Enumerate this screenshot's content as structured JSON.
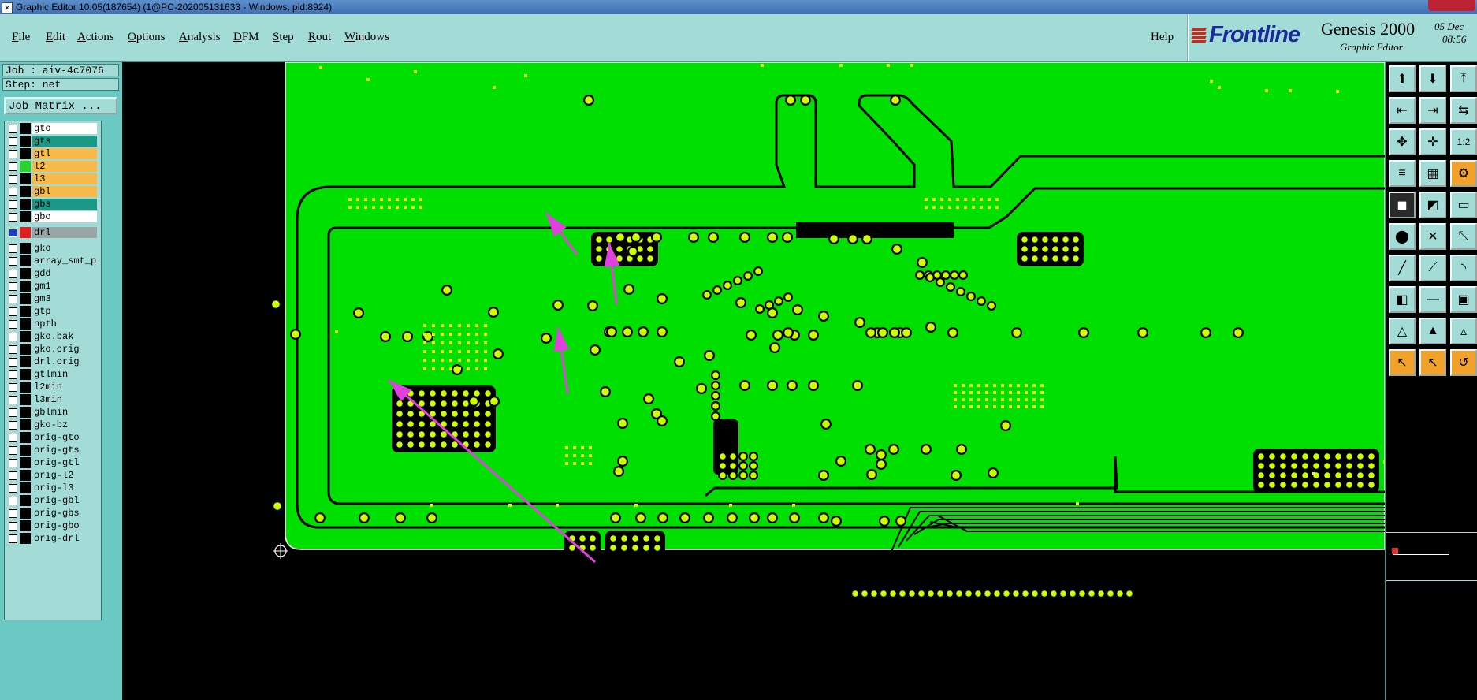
{
  "window": {
    "title": "Graphic Editor 10.05(187654) (1@PC-202005131633 - Windows, pid:8924)",
    "icon": "app-icon"
  },
  "menubar": {
    "items": [
      {
        "label": "File",
        "u": "F",
        "rest": "ile"
      },
      {
        "label": "Edit",
        "u": "E",
        "rest": "dit"
      },
      {
        "label": "Actions",
        "u": "A",
        "rest": "ctions"
      },
      {
        "label": "Options",
        "u": "O",
        "rest": "ptions"
      },
      {
        "label": "Analysis",
        "u": "A",
        "rest": "nalysis"
      },
      {
        "label": "DFM",
        "u": "D",
        "rest": "FM"
      },
      {
        "label": "Step",
        "u": "S",
        "rest": "tep"
      },
      {
        "label": "Rout",
        "u": "R",
        "rest": "out"
      },
      {
        "label": "Windows",
        "u": "W",
        "rest": "indows"
      }
    ],
    "help": "Help"
  },
  "brand": {
    "logo": "Frontline",
    "product": "Genesis 2000",
    "subtitle": "Graphic Editor",
    "date_top": "05 Dec",
    "date_bottom": "08:56"
  },
  "left": {
    "job": "Job : aiv-4c7076",
    "step": "Step: net",
    "job_matrix": "Job Matrix ...",
    "layers": [
      {
        "name": "gto",
        "color": "#ffffff",
        "swatch": "#000000"
      },
      {
        "name": "gts",
        "color": "#1a9a86",
        "swatch": "#000000"
      },
      {
        "name": "gtl",
        "color": "#f7b94a",
        "swatch": "#000000"
      },
      {
        "name": "l2",
        "color": "#f7b94a",
        "swatch": "#2bd22b"
      },
      {
        "name": "l3",
        "color": "#f7b94a",
        "swatch": "#000000"
      },
      {
        "name": "gbl",
        "color": "#f7b94a",
        "swatch": "#000000"
      },
      {
        "name": "gbs",
        "color": "#1a9a86",
        "swatch": "#000000"
      },
      {
        "name": "gbo",
        "color": "#ffffff",
        "swatch": "#000000"
      },
      {
        "name": "drl",
        "color": "#9aa6a6",
        "swatch": "#e02020",
        "active": true
      },
      {
        "name": "gko",
        "color": "#a3dcd6",
        "swatch": "#000000"
      },
      {
        "name": "array_smt_p",
        "color": "#a3dcd6",
        "swatch": "#000000"
      },
      {
        "name": "gdd",
        "color": "#a3dcd6",
        "swatch": "#000000"
      },
      {
        "name": "gm1",
        "color": "#a3dcd6",
        "swatch": "#000000"
      },
      {
        "name": "gm3",
        "color": "#a3dcd6",
        "swatch": "#000000"
      },
      {
        "name": "gtp",
        "color": "#a3dcd6",
        "swatch": "#000000"
      },
      {
        "name": "npth",
        "color": "#a3dcd6",
        "swatch": "#000000"
      },
      {
        "name": "gko.bak",
        "color": "#a3dcd6",
        "swatch": "#000000"
      },
      {
        "name": "gko.orig",
        "color": "#a3dcd6",
        "swatch": "#000000"
      },
      {
        "name": "drl.orig",
        "color": "#a3dcd6",
        "swatch": "#000000"
      },
      {
        "name": "gtlmin",
        "color": "#a3dcd6",
        "swatch": "#000000"
      },
      {
        "name": "l2min",
        "color": "#a3dcd6",
        "swatch": "#000000"
      },
      {
        "name": "l3min",
        "color": "#a3dcd6",
        "swatch": "#000000"
      },
      {
        "name": "gblmin",
        "color": "#a3dcd6",
        "swatch": "#000000"
      },
      {
        "name": "gko-bz",
        "color": "#a3dcd6",
        "swatch": "#000000"
      },
      {
        "name": "orig-gto",
        "color": "#a3dcd6",
        "swatch": "#000000"
      },
      {
        "name": "orig-gts",
        "color": "#a3dcd6",
        "swatch": "#000000"
      },
      {
        "name": "orig-gtl",
        "color": "#a3dcd6",
        "swatch": "#000000"
      },
      {
        "name": "orig-l2",
        "color": "#a3dcd6",
        "swatch": "#000000"
      },
      {
        "name": "orig-l3",
        "color": "#a3dcd6",
        "swatch": "#000000"
      },
      {
        "name": "orig-gbl",
        "color": "#a3dcd6",
        "swatch": "#000000"
      },
      {
        "name": "orig-gbs",
        "color": "#a3dcd6",
        "swatch": "#000000"
      },
      {
        "name": "orig-gbo",
        "color": "#a3dcd6",
        "swatch": "#000000"
      },
      {
        "name": "orig-drl",
        "color": "#a3dcd6",
        "swatch": "#000000"
      }
    ]
  },
  "colors": {
    "copper": "#00e000",
    "pad": "#ccff00",
    "annotation_arrow": "#e040e0",
    "panel": "#a3dcd6",
    "panel_dark": "#6bc9c3"
  },
  "toolbar": {
    "buttons": [
      {
        "icon": "open-icon",
        "glyph": "⬆",
        "style": "normal"
      },
      {
        "icon": "save-icon",
        "glyph": "⬇",
        "style": "normal"
      },
      {
        "icon": "zoom-up-icon",
        "glyph": "⤒",
        "style": "normal"
      },
      {
        "icon": "import-icon",
        "glyph": "⇤",
        "style": "normal"
      },
      {
        "icon": "export-icon",
        "glyph": "⇥",
        "style": "normal"
      },
      {
        "icon": "sides-icon",
        "glyph": "⇆",
        "style": "normal"
      },
      {
        "icon": "zoom-fit-icon",
        "glyph": "✥",
        "style": "normal"
      },
      {
        "icon": "pan-icon",
        "glyph": "✛",
        "style": "normal"
      },
      {
        "icon": "scale-1to2-icon",
        "glyph": "1:2",
        "style": "normal"
      },
      {
        "icon": "stack-icon",
        "glyph": "≡",
        "style": "normal"
      },
      {
        "icon": "grid-icon",
        "glyph": "▦",
        "style": "normal"
      },
      {
        "icon": "net-icon",
        "glyph": "⚙",
        "style": "orange"
      },
      {
        "icon": "select-box-icon",
        "glyph": "◼",
        "style": "dark"
      },
      {
        "icon": "edit-shape-icon",
        "glyph": "◩",
        "style": "normal"
      },
      {
        "icon": "ruler-icon",
        "glyph": "▭",
        "style": "normal"
      },
      {
        "icon": "connect-icon",
        "glyph": "⬤",
        "style": "normal"
      },
      {
        "icon": "cross-icon",
        "glyph": "✕",
        "style": "normal"
      },
      {
        "icon": "link-icon",
        "glyph": "⤡",
        "style": "normal"
      },
      {
        "icon": "line-icon",
        "glyph": "╱",
        "style": "normal"
      },
      {
        "icon": "diagonal-icon",
        "glyph": "⟋",
        "style": "normal"
      },
      {
        "icon": "arc-icon",
        "glyph": "◝",
        "style": "normal"
      },
      {
        "icon": "pad-add-icon",
        "glyph": "◧",
        "style": "normal"
      },
      {
        "icon": "line-move-icon",
        "glyph": "―",
        "style": "normal"
      },
      {
        "icon": "component-icon",
        "glyph": "▣",
        "style": "normal"
      },
      {
        "icon": "triangle-icon",
        "glyph": "△",
        "style": "normal"
      },
      {
        "icon": "triangle-alt-icon",
        "glyph": "▲",
        "style": "normal"
      },
      {
        "icon": "triangle-edit-icon",
        "glyph": "▵",
        "style": "normal"
      },
      {
        "icon": "pointer-icon",
        "glyph": "↖",
        "style": "orange"
      },
      {
        "icon": "pointer-select-icon",
        "glyph": "↖",
        "style": "orange"
      },
      {
        "icon": "pointer-rotate-icon",
        "glyph": "↺",
        "style": "orange"
      }
    ]
  }
}
